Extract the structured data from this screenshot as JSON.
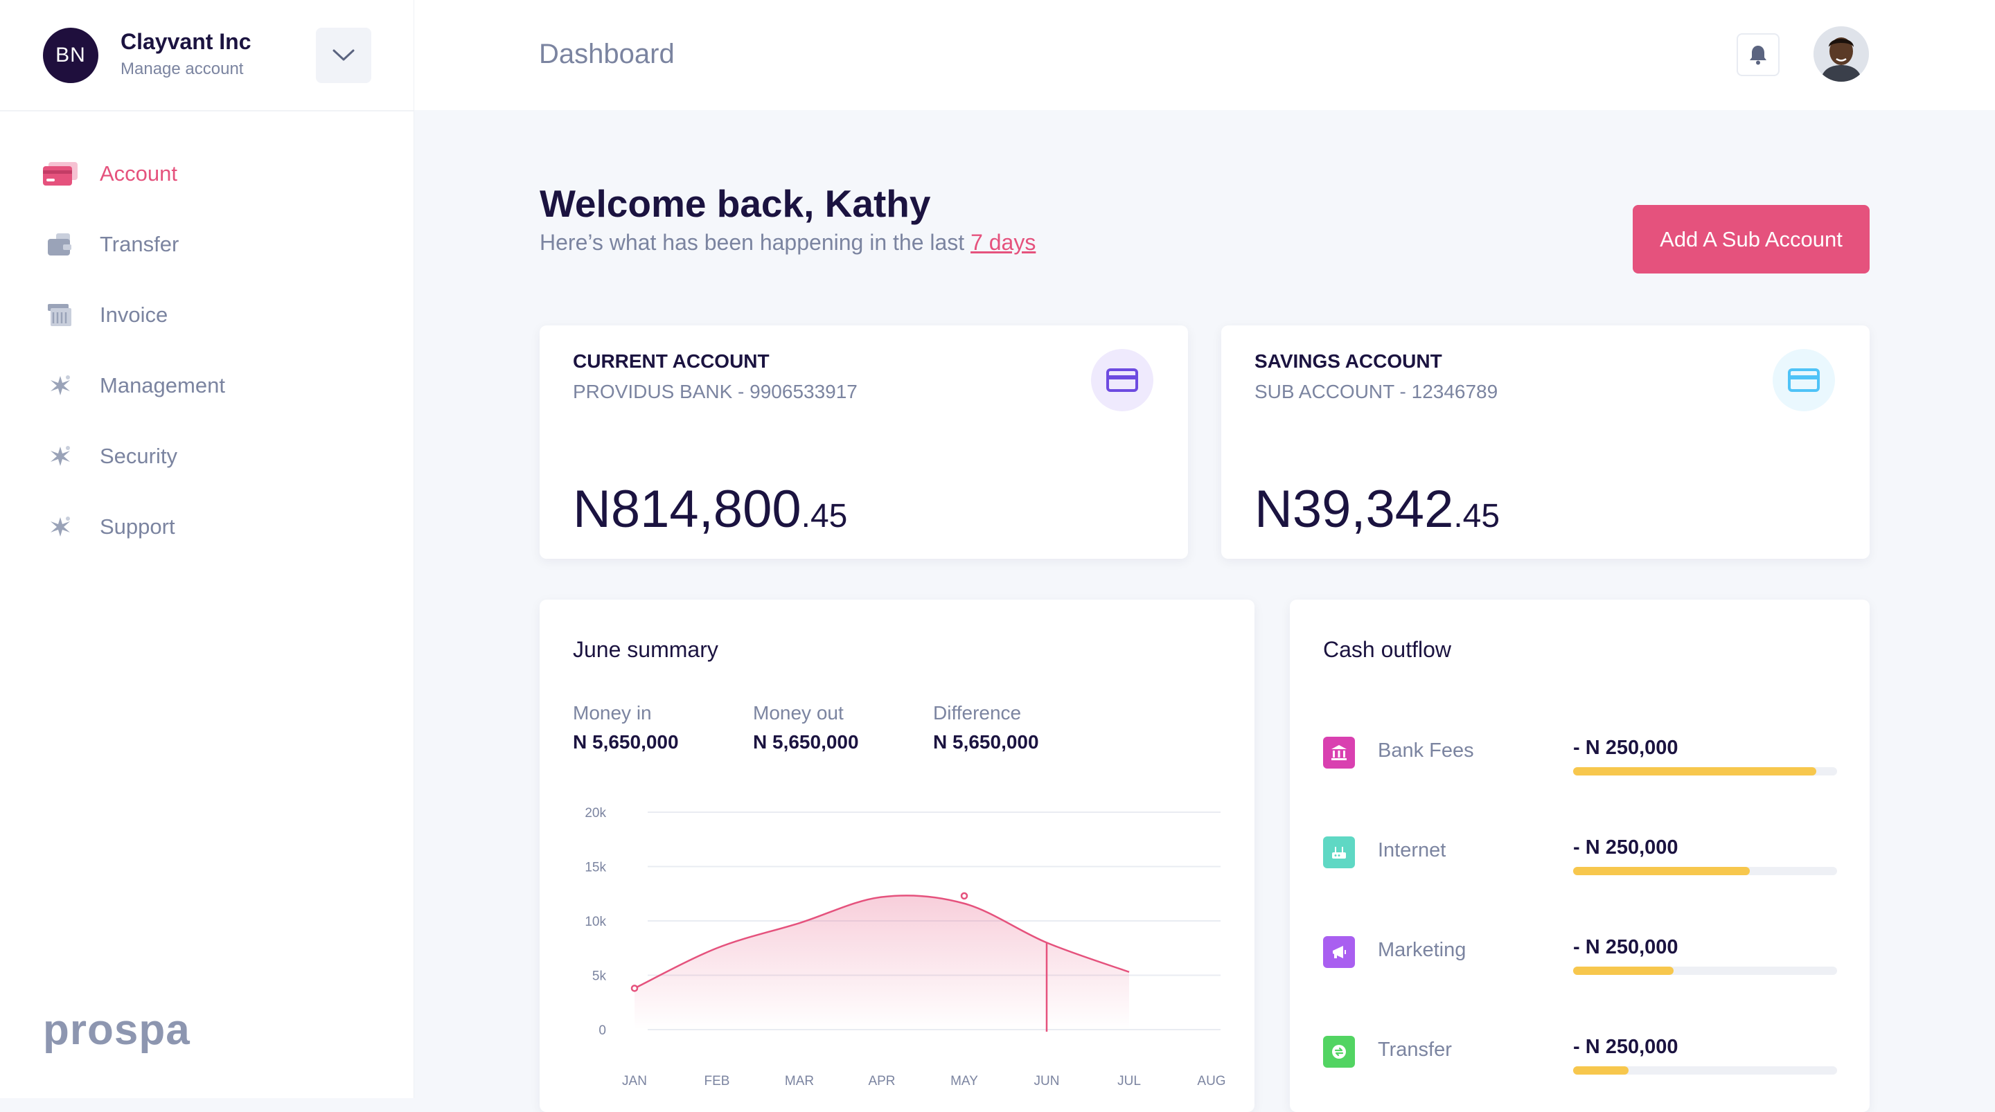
{
  "org": {
    "initials": "BN",
    "name": "Clayvant Inc",
    "subtitle": "Manage account"
  },
  "nav": [
    {
      "label": "Account",
      "icon": "card-icon",
      "active": true
    },
    {
      "label": "Transfer",
      "icon": "wallet-icon",
      "active": false
    },
    {
      "label": "Invoice",
      "icon": "invoice-icon",
      "active": false
    },
    {
      "label": "Management",
      "icon": "spark-icon",
      "active": false
    },
    {
      "label": "Security",
      "icon": "spark-icon",
      "active": false
    },
    {
      "label": "Support",
      "icon": "spark-icon",
      "active": false
    }
  ],
  "brand": "prospa",
  "header": {
    "title": "Dashboard"
  },
  "welcome": {
    "title": "Welcome back, Kathy",
    "subtitle_prefix": "Here’s what has been happening in the last",
    "subtitle_link": "7 days"
  },
  "add_sub_account_label": "Add A Sub Account",
  "accounts": [
    {
      "title": "CURRENT ACCOUNT",
      "subtitle": "PROVIDUS BANK - 9906533917",
      "amount_main": "N814,800",
      "amount_dec": ".45",
      "icon_color": "#6d4be0",
      "icon_bg": "#efeafd"
    },
    {
      "title": "SAVINGS ACCOUNT",
      "subtitle": "SUB ACCOUNT - 12346789",
      "amount_main": "N39,342",
      "amount_dec": ".45",
      "icon_color": "#4fc3f7",
      "icon_bg": "#eaf8fe"
    }
  ],
  "summary": {
    "title": "June summary",
    "stats": [
      {
        "label": "Money in",
        "value": "N 5,650,000"
      },
      {
        "label": "Money out",
        "value": "N 5,650,000"
      },
      {
        "label": "Difference",
        "value": "N 5,650,000"
      }
    ]
  },
  "chart_data": {
    "type": "area",
    "categories": [
      "JAN",
      "FEB",
      "MAR",
      "APR",
      "MAY",
      "JUN",
      "JUL",
      "AUG"
    ],
    "yticks": [
      "20k",
      "15k",
      "10k",
      "5k",
      "0"
    ],
    "ylim": [
      0,
      20000
    ],
    "series": [
      {
        "values": [
          3800,
          7500,
          9800,
          12200,
          11600,
          8000,
          5300
        ]
      }
    ],
    "highlight_index": 5,
    "marked_point": {
      "x": "MAY",
      "y": 12300
    },
    "color": "#e5527d"
  },
  "outflow": {
    "title": "Cash outflow",
    "items": [
      {
        "label": "Bank Fees",
        "amount": "- N 250,000",
        "fraction": 0.92,
        "icon": "bank-icon",
        "color": "#d940b0"
      },
      {
        "label": "Internet",
        "amount": "- N 250,000",
        "fraction": 0.67,
        "icon": "router-icon",
        "color": "#5fd8c4"
      },
      {
        "label": "Marketing",
        "amount": "- N 250,000",
        "fraction": 0.38,
        "icon": "megaphone-icon",
        "color": "#a95ff0"
      },
      {
        "label": "Transfer",
        "amount": "- N 250,000",
        "fraction": 0.21,
        "icon": "transfer-icon",
        "color": "#52d462"
      }
    ]
  }
}
